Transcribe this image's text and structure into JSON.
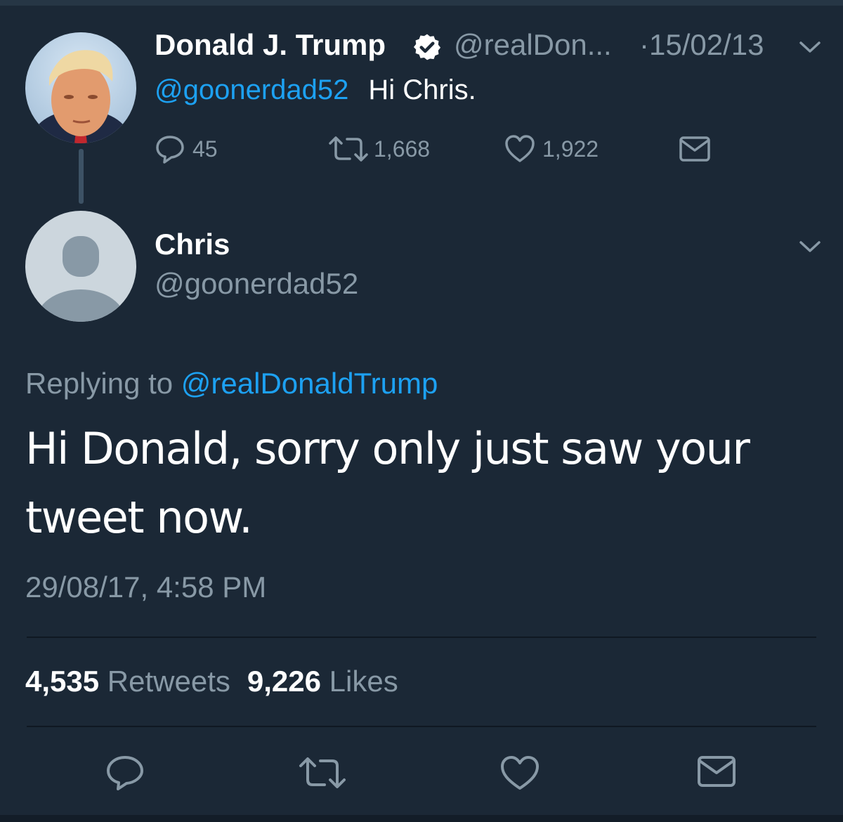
{
  "parent_tweet": {
    "author_name": "Donald J. Trump",
    "author_handle": "@realDon...",
    "date": "·15/02/13",
    "mention": "@goonerdad52",
    "text": "Hi Chris.",
    "reply_count": "45",
    "retweet_count": "1,668",
    "like_count": "1,922",
    "verified_icon": "verified-badge-icon"
  },
  "reply_tweet": {
    "author_name": "Chris",
    "author_handle": "@goonerdad52",
    "replying_label": "Replying to",
    "replying_mention": "@realDonaldTrump",
    "text": "Hi Donald, sorry only just saw your tweet now.",
    "timestamp": "29/08/17, 4:58 PM",
    "retweets_count": "4,535",
    "retweets_label": "Retweets",
    "likes_count": "9,226",
    "likes_label": "Likes"
  },
  "icons": [
    "chevron-down-icon",
    "reply-icon",
    "retweet-icon",
    "like-icon",
    "direct-message-icon",
    "avatar-placeholder-icon"
  ],
  "colors": {
    "background": "#1b2836",
    "link": "#1da1f2",
    "muted": "#8899a6",
    "text": "#ffffff",
    "verified_badge": "#ffffff"
  }
}
